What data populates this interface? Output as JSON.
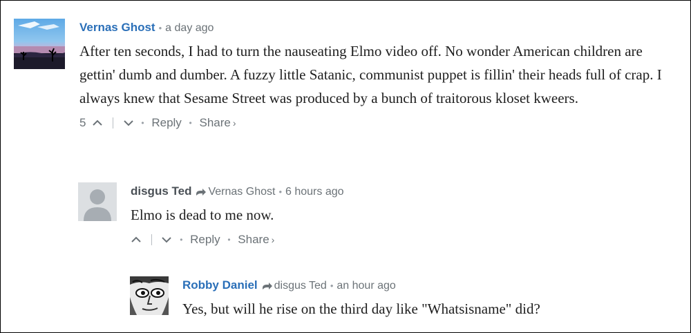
{
  "comments": [
    {
      "author": "Vernas Ghost",
      "time": "a day ago",
      "text": "After ten seconds, I had to turn the nauseating Elmo video off. No wonder American children are gettin' dumb and dumber. A fuzzy little Satanic, communist puppet is fillin' their heads full of crap. I always knew that Sesame Street was produced by a bunch of traitorous kloset kweers.",
      "votes": "5",
      "reply_label": "Reply",
      "share_label": "Share",
      "share_chevron": "›"
    },
    {
      "author": "disgus Ted",
      "reply_to": "Vernas Ghost",
      "time": "6 hours ago",
      "text": "Elmo is dead to me now.",
      "reply_label": "Reply",
      "share_label": "Share",
      "share_chevron": "›"
    },
    {
      "author": "Robby Daniel",
      "reply_to": "disgus Ted",
      "time": "an hour ago",
      "text": "Yes, but will he rise on the third day like \"Whatsisname\" did?"
    }
  ],
  "separator": "•",
  "icons": {
    "upvote": "chevron-up-icon",
    "downvote": "chevron-down-icon",
    "reply_to": "reply-arrow-icon",
    "default_avatar": "default-user-avatar-icon"
  },
  "colors": {
    "author": "#2a6fb8",
    "meta": "#6b7277",
    "body": "#1e1e1e"
  }
}
